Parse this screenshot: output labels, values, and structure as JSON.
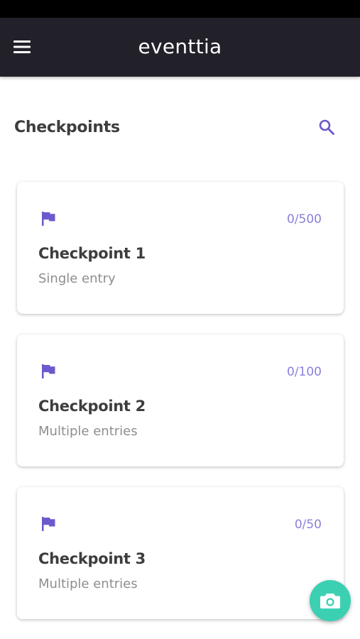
{
  "app": {
    "logo_text": "eventtia"
  },
  "header": {
    "title": "Checkpoints",
    "menu_icon": "hamburger-menu-icon",
    "search_icon": "search-icon"
  },
  "checkpoints": [
    {
      "name": "Checkpoint 1",
      "type": "Single entry",
      "count": "0/500",
      "icon": "flag-icon"
    },
    {
      "name": "Checkpoint 2",
      "type": "Multiple entries",
      "count": "0/100",
      "icon": "flag-icon"
    },
    {
      "name": "Checkpoint 3",
      "type": "Multiple entries",
      "count": "0/50",
      "icon": "flag-icon"
    }
  ],
  "fab": {
    "icon": "camera-icon"
  },
  "colors": {
    "appbar": "#222129",
    "accent_purple": "#6a5acd",
    "count_text": "#8a80dd",
    "fab": "#3cd0b3",
    "title_text": "#3d3d3d",
    "subtitle_text": "#8e8e8e"
  }
}
